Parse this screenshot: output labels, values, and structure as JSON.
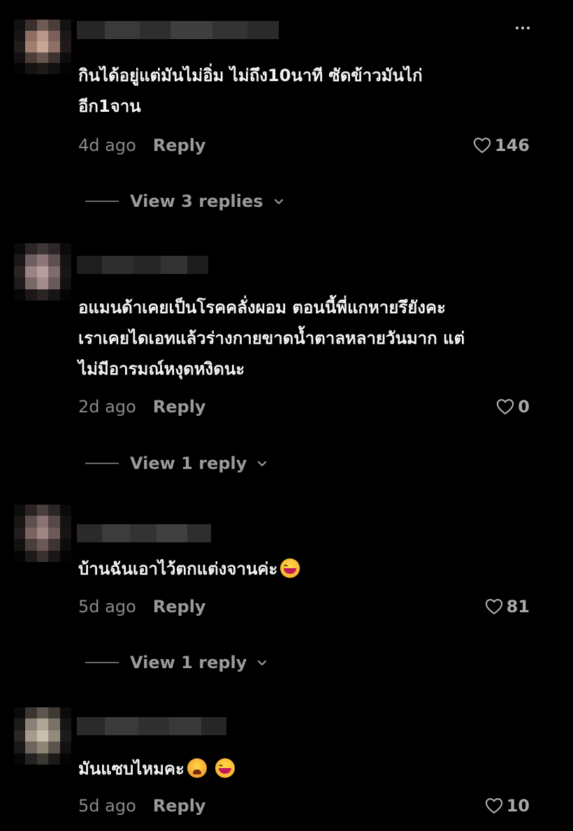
{
  "comments": [
    {
      "text": "กินได้อยู่แต่มันไม่อิ่ม ไม่ถึง10นาที ซัดข้าวมันไก่\nอีก1จาน",
      "time": "4d ago",
      "reply_label": "Reply",
      "likes": "146",
      "view_replies": "View 3 replies"
    },
    {
      "text": "อแมนด้าเคยเป็นโรคคลั่งผอม ตอนนี้พี่แกหายรึยังคะ\nเราเคยไดเอทแล้วร่างกายขาดน้ำตาลหลายวันมาก แต่\nไม่มีอารมณ์หงุดหงิดนะ",
      "time": "2d ago",
      "reply_label": "Reply",
      "likes": "0",
      "view_replies": "View 1 reply"
    },
    {
      "text": "บ้านฉันเอาไว้ตกแต่งจานค่ะ",
      "emoji": [
        "laughing-crying"
      ],
      "time": "5d ago",
      "reply_label": "Reply",
      "likes": "81",
      "view_replies": "View 1 reply"
    },
    {
      "text": "มันแซบไหมคะ",
      "emoji": [
        "tired-face",
        "laughing-crying"
      ],
      "time": "5d ago",
      "reply_label": "Reply",
      "likes": "10"
    }
  ],
  "colors": {
    "background": "#000000",
    "text": "#f3f3f3",
    "muted": "#8a8a8a"
  }
}
